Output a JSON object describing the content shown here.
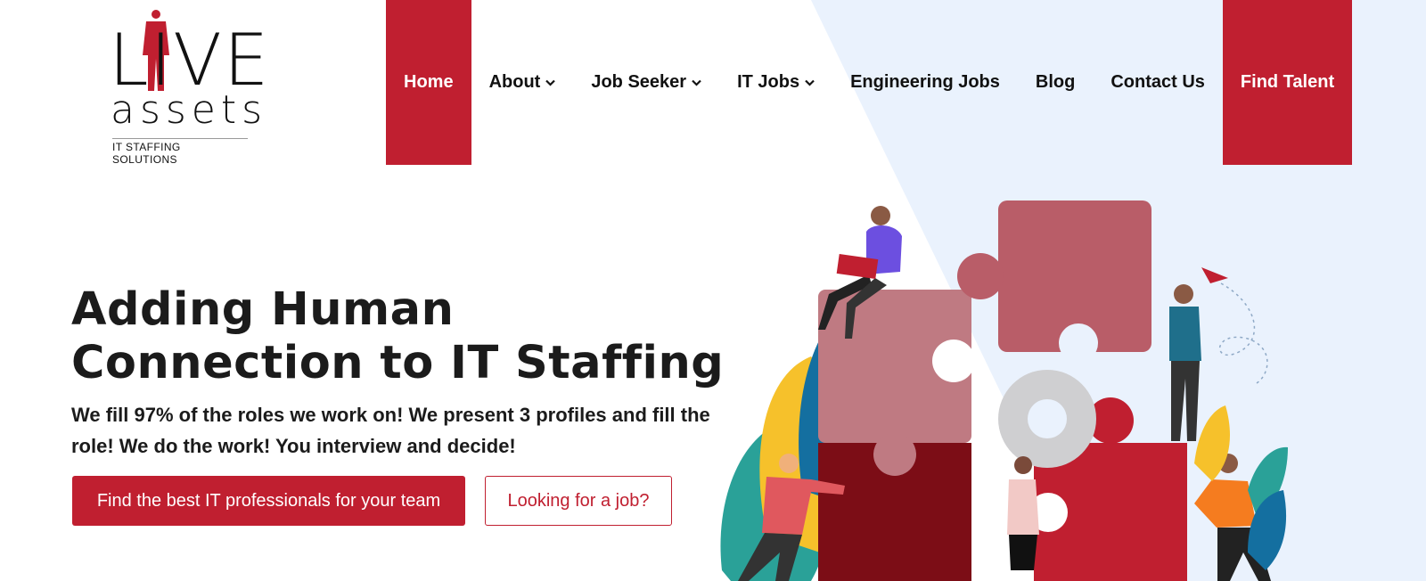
{
  "logo": {
    "word_live": "LIVE",
    "word_assets": "assets",
    "tagline": "IT STAFFING SOLUTIONS"
  },
  "nav": {
    "items": [
      {
        "label": "Home",
        "active": true,
        "dropdown": false
      },
      {
        "label": "About",
        "active": false,
        "dropdown": true
      },
      {
        "label": "Job Seeker",
        "active": false,
        "dropdown": true
      },
      {
        "label": "IT Jobs",
        "active": false,
        "dropdown": true
      },
      {
        "label": "Engineering Jobs",
        "active": false,
        "dropdown": false
      },
      {
        "label": "Blog",
        "active": false,
        "dropdown": false
      },
      {
        "label": "Contact Us",
        "active": false,
        "dropdown": false
      }
    ],
    "cta_label": "Find Talent",
    "chevron_icon": "chevron-down-icon"
  },
  "hero": {
    "title_line1": "Adding Human",
    "title_line2": "Connection to IT Staffing",
    "subtitle": "We fill 97% of the roles we work on! We present 3 profiles and fill the role! We do the work! You interview and decide!",
    "primary_button": "Find the best IT professionals for your team",
    "secondary_button": "Looking for a job?"
  },
  "colors": {
    "brand_red": "#c01f30",
    "light_blue_bg": "#eaf2fd",
    "text_dark": "#1b1b1b"
  }
}
